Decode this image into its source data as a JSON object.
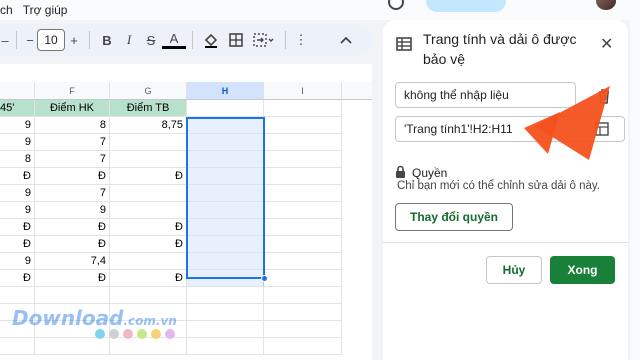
{
  "menu": {
    "items": [
      "ch",
      "Trợ giúp"
    ]
  },
  "toolbar": {
    "font_size": "10"
  },
  "sheet": {
    "columns": [
      "F",
      "G",
      "H",
      "I"
    ],
    "selected_column": "H",
    "left_partial_header": "45'",
    "headers": {
      "F": "Điểm HK",
      "G": "Điểm TB"
    },
    "rows": [
      {
        "e": "9",
        "f": "8",
        "g": "8,75"
      },
      {
        "e": "9",
        "f": "7",
        "g": ""
      },
      {
        "e": "8",
        "f": "7",
        "g": ""
      },
      {
        "e": "Đ",
        "f": "Đ",
        "g": "Đ"
      },
      {
        "e": "9",
        "f": "7",
        "g": ""
      },
      {
        "e": "9",
        "f": "9",
        "g": ""
      },
      {
        "e": "Đ",
        "f": "Đ",
        "g": "Đ"
      },
      {
        "e": "Đ",
        "f": "Đ",
        "g": "Đ"
      },
      {
        "e": "9",
        "f": "7,4",
        "g": ""
      },
      {
        "e": "Đ",
        "f": "Đ",
        "g": "Đ"
      }
    ]
  },
  "panel": {
    "title": "Trang tính và dải ô được bảo vệ",
    "description_value": "không thể nhập liệu",
    "range_value": "'Trang tính1'!H2:H11",
    "permissions_title": "Quyền",
    "permissions_desc": "Chỉ bạn mới có thể chỉnh sửa dải ô này.",
    "change_permissions_label": "Thay đổi quyền",
    "cancel_label": "Hủy",
    "done_label": "Xong"
  },
  "watermark": {
    "text": "Download",
    "suffix": ".com.vn"
  },
  "colors": {
    "accent": "#188038",
    "selection": "#1a73e8",
    "header_fill": "#b7e1cd",
    "arrow": "#f4511e"
  },
  "icons": [
    "table-icon",
    "close-icon",
    "delete-icon",
    "grid-select-icon",
    "lock-icon",
    "bold-icon",
    "italic-icon",
    "strikethrough-icon",
    "text-color-icon",
    "fill-color-icon",
    "borders-icon",
    "merge-icon",
    "collapse-icon"
  ]
}
